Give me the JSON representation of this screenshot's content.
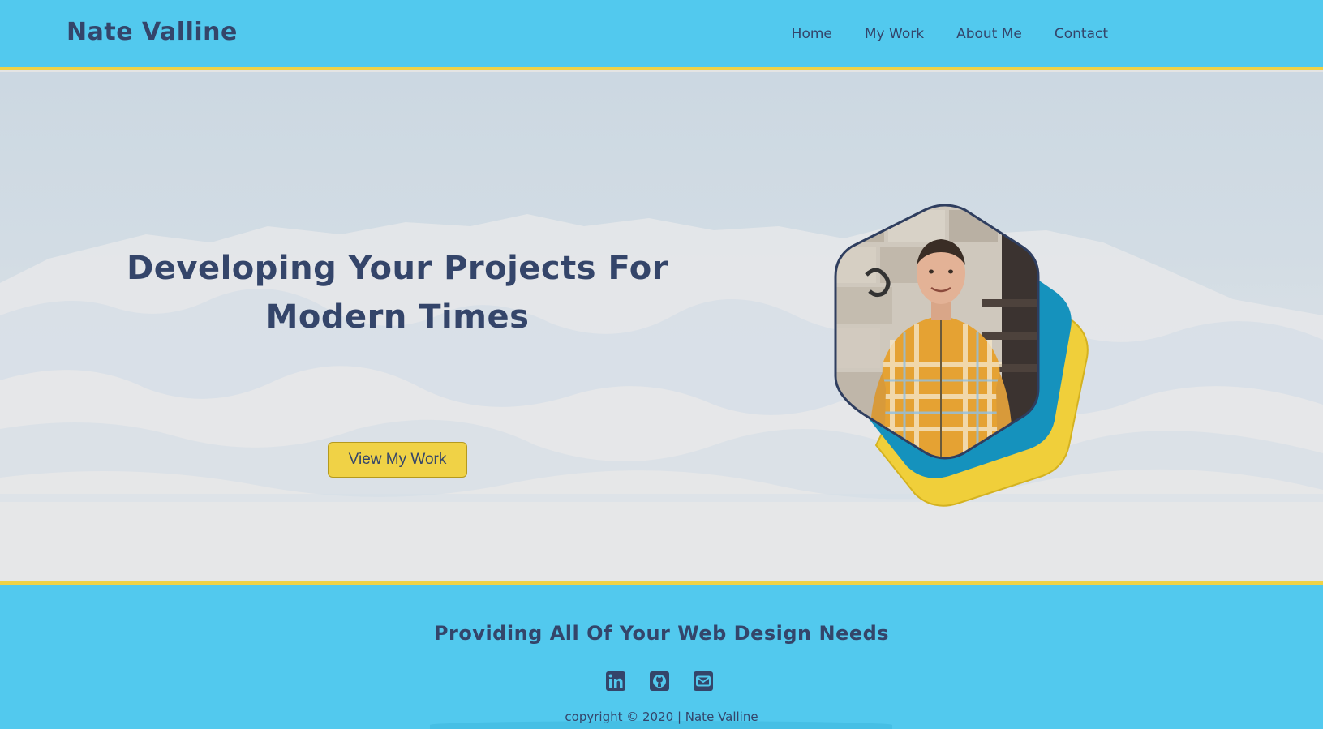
{
  "header": {
    "brand": "Nate Valline",
    "nav": [
      "Home",
      "My Work",
      "About Me",
      "Contact"
    ]
  },
  "hero": {
    "headline_line1": "Developing Your Projects For",
    "headline_line2": "Modern Times",
    "cta_label": "View My Work"
  },
  "footer": {
    "title": "Providing All Of Your Web Design Needs",
    "socials": [
      "linkedin-icon",
      "github-icon",
      "email-icon"
    ],
    "copyright": "copyright © 2020 | Nate Valline"
  },
  "colors": {
    "header_bg": "#52c9ee",
    "accent_yellow": "#f0d246",
    "accent_blue": "#1592bd",
    "text_navy": "#34456a"
  }
}
